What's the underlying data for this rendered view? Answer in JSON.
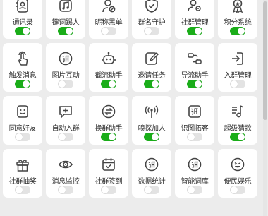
{
  "accent_color": "#1aad19",
  "features": [
    {
      "label": "通讯录",
      "icon": "contacts-icon",
      "enabled": true
    },
    {
      "label": "键词踢人",
      "icon": "kick-keyword-icon",
      "enabled": true
    },
    {
      "label": "昵称黑单",
      "icon": "user-block-icon",
      "enabled": false
    },
    {
      "label": "群名守护",
      "icon": "shield-check-icon",
      "enabled": false
    },
    {
      "label": "社群管理",
      "icon": "group-settings-icon",
      "enabled": true
    },
    {
      "label": "积分系统",
      "icon": "medal-icon",
      "enabled": true
    },
    {
      "label": "触发消息",
      "icon": "touch-icon",
      "enabled": true
    },
    {
      "label": "图片互动",
      "icon": "tiao-circle-icon",
      "enabled": false
    },
    {
      "label": "截流助手",
      "icon": "robot-icon",
      "enabled": true
    },
    {
      "label": "邀请任务",
      "icon": "edit-square-icon",
      "enabled": true
    },
    {
      "label": "导流助手",
      "icon": "flow-icon",
      "enabled": true
    },
    {
      "label": "入群管理",
      "icon": "enter-icon",
      "enabled": false
    },
    {
      "label": "同意好友",
      "icon": "smile-face-icon",
      "enabled": false
    },
    {
      "label": "自动入群",
      "icon": "add-chat-icon",
      "enabled": false
    },
    {
      "label": "换群助手",
      "icon": "swap-icon",
      "enabled": true
    },
    {
      "label": "嗅探加人",
      "icon": "signal-icon",
      "enabled": true
    },
    {
      "label": "识图拓客",
      "icon": "tiao-square-icon",
      "enabled": false
    },
    {
      "label": "超级猜歌",
      "icon": "music-icon",
      "enabled": true
    },
    {
      "label": "社群抽奖",
      "icon": "gift-icon",
      "enabled": false
    },
    {
      "label": "消息监控",
      "icon": "eye-icon",
      "enabled": false
    },
    {
      "label": "社群签到",
      "icon": "calendar-check-icon",
      "enabled": false
    },
    {
      "label": "数据统计",
      "icon": "stats-icon",
      "enabled": false
    },
    {
      "label": "智能词库",
      "icon": "lexicon-icon",
      "enabled": false
    },
    {
      "label": "便民娱乐",
      "icon": "fun-icon",
      "enabled": false
    }
  ]
}
